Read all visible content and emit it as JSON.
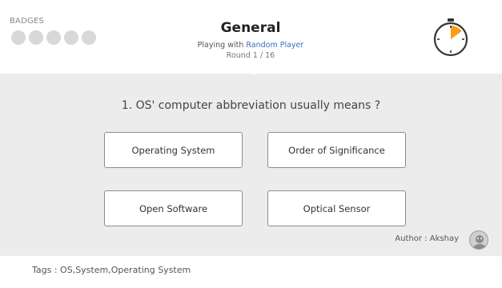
{
  "badges": {
    "label": "BADGES",
    "count": 5
  },
  "game": {
    "title": "General",
    "playing_prefix": "Playing with",
    "opponent": "Random Player",
    "round": "Round 1 / 16"
  },
  "timer": {
    "icon": "stopwatch-icon",
    "elapsed_fraction": 0.15,
    "accent_color": "#f5a01a"
  },
  "question": {
    "text": "1. OS' computer abbreviation usually means ?"
  },
  "answers": [
    {
      "label": "Operating System"
    },
    {
      "label": "Order of Significance"
    },
    {
      "label": "Open Software"
    },
    {
      "label": "Optical Sensor"
    }
  ],
  "author": {
    "label": "Author :",
    "name": "Akshay",
    "avatar_icon": "user-avatar-icon"
  },
  "tags": {
    "text": "Tags : OS,System,Operating System"
  },
  "colors": {
    "panel_bg": "#ececec",
    "link": "#3a6cc7",
    "badge_empty": "#d8d8d8"
  }
}
